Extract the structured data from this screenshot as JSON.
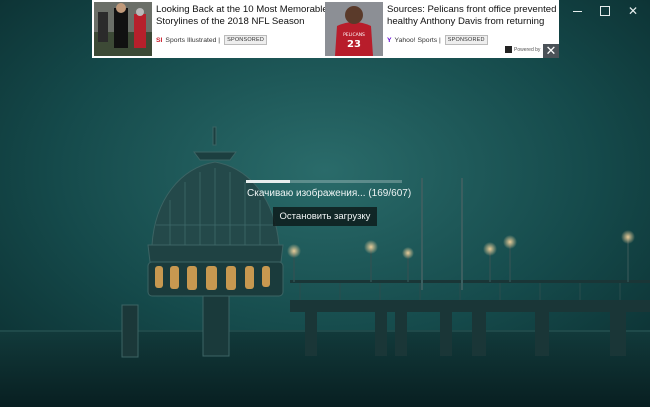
{
  "window": {
    "minimize_icon": "minimize-icon",
    "maximize_icon": "maximize-icon",
    "close_icon": "close-icon",
    "close_glyph": "✕"
  },
  "ad": {
    "items": [
      {
        "title": "Looking Back at the 10 Most Memorable Storylines of the 2018 NFL Season",
        "source_logo": "SI",
        "source": "Sports Illustrated |",
        "badge": "SPONSORED"
      },
      {
        "title": "Sources: Pelicans front office prevented healthy Anthony Davis from returning",
        "source_logo": "Y",
        "source": "Yahoo! Sports |",
        "badge": "SPONSORED",
        "jersey_number": "23",
        "jersey_team": "PELICANS"
      }
    ],
    "powered_by": "Powered by",
    "close_glyph": "✕"
  },
  "loader": {
    "progress_fraction": 0.28,
    "status_text": "Скачиваю изображения... (169/607)",
    "stop_button_label": "Остановить загрузку"
  },
  "colors": {
    "background": "#0f3a3c",
    "ad_background": "#ffffff",
    "si_red": "#cc1f2d",
    "yahoo_purple": "#5f01d1"
  }
}
